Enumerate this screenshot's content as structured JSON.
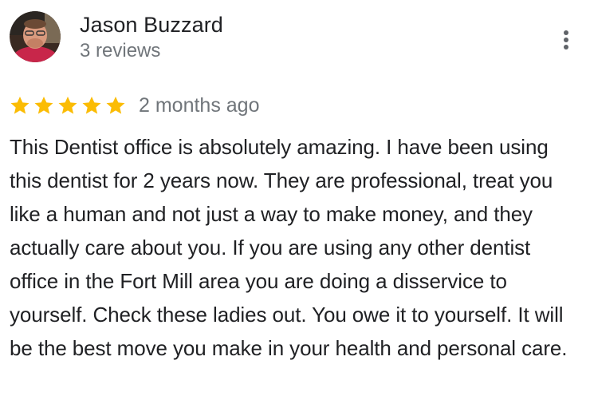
{
  "review": {
    "author": {
      "name": "Jason Buzzard",
      "reviews_count": "3 reviews"
    },
    "rating": 5,
    "rating_max": 5,
    "date": "2 months ago",
    "text": "This Dentist office is absolutely amazing. I have been using this dentist for 2 years now. They are professional, treat you like a human and not just a way to make money, and they actually care about you. If you are using any other dentist office in the Fort Mill area you are doing a disservice to yourself. Check these ladies out. You owe it to yourself. It will be the best move you make in your health and personal care."
  },
  "icons": {
    "star": "star-icon",
    "more": "more-vert-icon"
  },
  "colors": {
    "star": "#fbbc04",
    "secondary_text": "#70757a",
    "primary_text": "#202124"
  }
}
